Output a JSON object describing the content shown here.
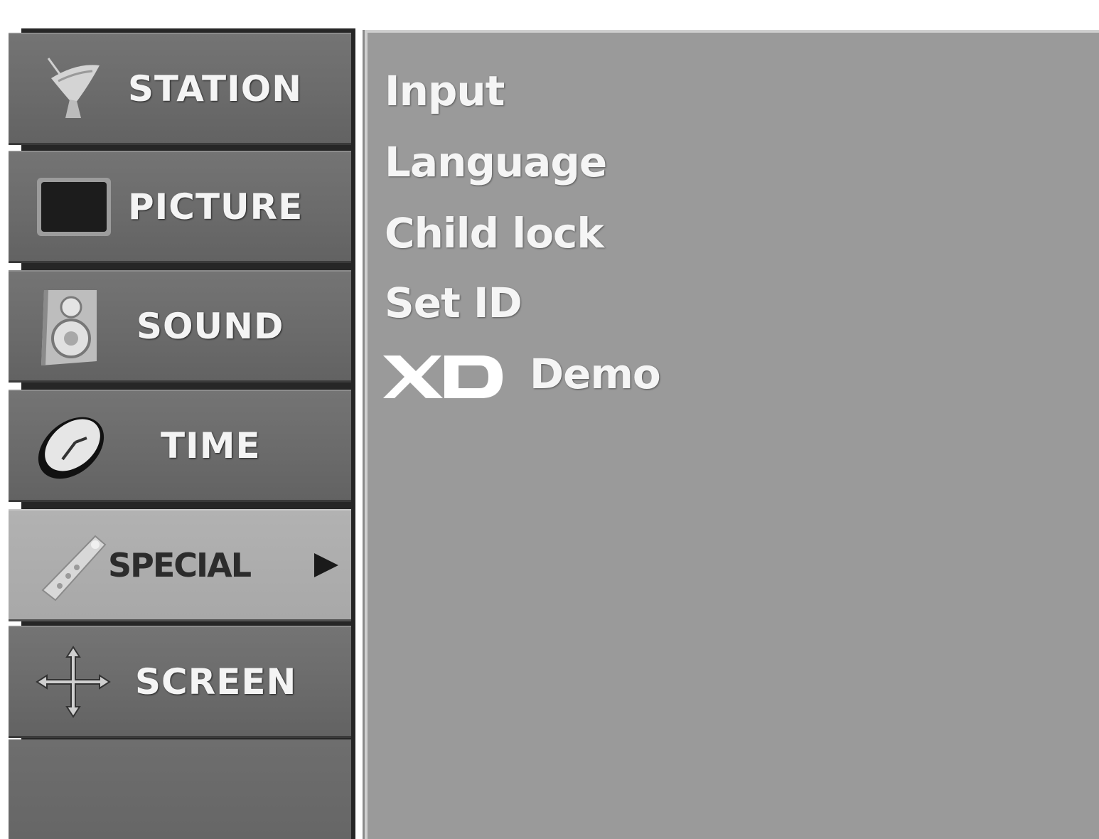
{
  "menu": {
    "items": [
      {
        "label": "STATION",
        "icon": "satellite-dish-icon",
        "selected": false
      },
      {
        "label": "PICTURE",
        "icon": "picture-screen-icon",
        "selected": false
      },
      {
        "label": "SOUND",
        "icon": "speaker-icon",
        "selected": false
      },
      {
        "label": "TIME",
        "icon": "clock-icon",
        "selected": false
      },
      {
        "label": "SPECIAL",
        "icon": "remote-control-icon",
        "selected": true
      },
      {
        "label": "SCREEN",
        "icon": "move-arrows-icon",
        "selected": false
      }
    ],
    "selected_arrow": "▶"
  },
  "submenu": {
    "items": [
      {
        "label": "Input"
      },
      {
        "label": "Language"
      },
      {
        "label": "Child lock"
      },
      {
        "label": "Set ID"
      }
    ],
    "xd_demo": {
      "logo_text": "XD",
      "label": "Demo"
    }
  },
  "colors": {
    "menu_item_bg": "#6c6c6c",
    "menu_item_selected_bg": "#acacac",
    "submenu_bg": "#9a9a9a",
    "text": "#f4f4f4"
  }
}
